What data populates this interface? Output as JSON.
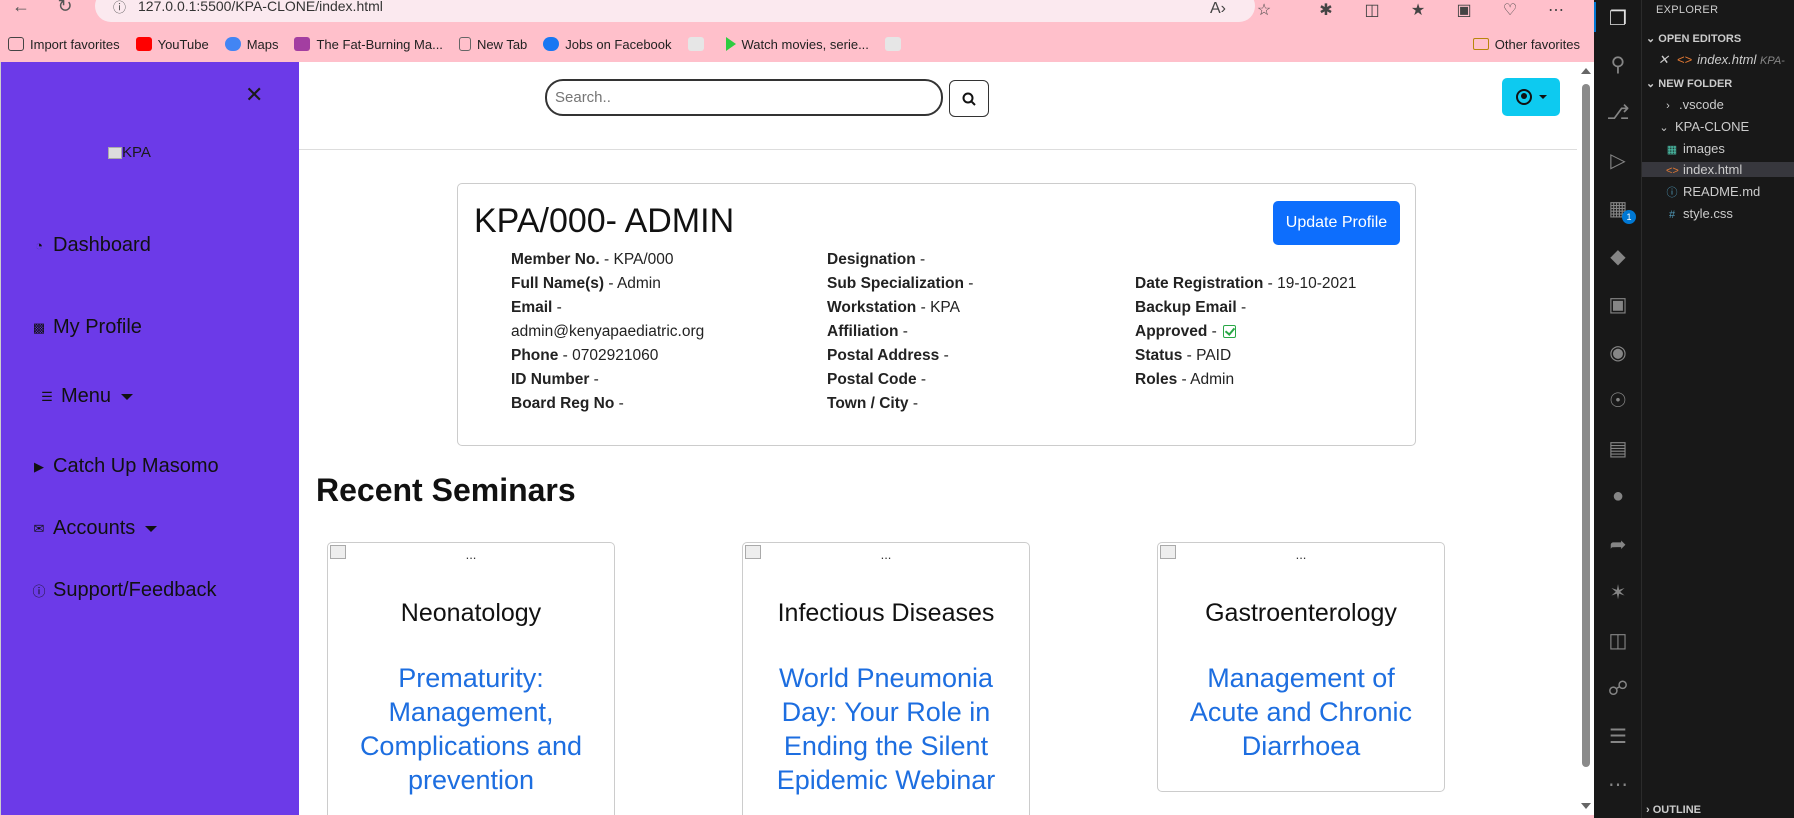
{
  "browser": {
    "url": "127.0.0.1:5500/KPA-CLONE/index.html",
    "favorites": [
      {
        "label": "Import favorites",
        "icon": "import-icon",
        "color": "#444444"
      },
      {
        "label": "YouTube",
        "icon": "youtube-icon",
        "color": "#ff0000"
      },
      {
        "label": "Maps",
        "icon": "google-icon",
        "color": "#4285f4"
      },
      {
        "label": "The Fat-Burning Ma...",
        "icon": "page-icon",
        "color": "#a33ea1"
      },
      {
        "label": "New Tab",
        "icon": "page-icon",
        "color": "#666666"
      },
      {
        "label": "Jobs on Facebook",
        "icon": "facebook-icon",
        "color": "#1877f2"
      },
      {
        "label": "",
        "icon": "page-icon",
        "color": "#dddddd"
      },
      {
        "label": "Watch movies, serie...",
        "icon": "play-icon",
        "color": "#2ecc40"
      },
      {
        "label": "",
        "icon": "page-icon",
        "color": "#dddddd"
      }
    ],
    "other_favorites": "Other favorites"
  },
  "sidebar": {
    "logo_alt": "KPA",
    "items": [
      {
        "label": "Dashboard",
        "icon": "gauge-icon"
      },
      {
        "label": "My Profile",
        "icon": "profile-icon"
      },
      {
        "label": "Menu",
        "icon": "menu-icon"
      },
      {
        "label": "Catch Up Masomo",
        "icon": "youtube-icon"
      },
      {
        "label": "Accounts",
        "icon": "envelope-icon"
      },
      {
        "label": "Support/Feedback",
        "icon": "question-icon"
      }
    ]
  },
  "search": {
    "placeholder": "Search.."
  },
  "profile": {
    "title": "KPA/000- ADMIN",
    "update_label": "Update Profile",
    "col1": [
      {
        "label": "Member No.",
        "value": "KPA/000"
      },
      {
        "label": "Full Name(s)",
        "value": "Admin"
      },
      {
        "label": "Email",
        "value": ""
      },
      {
        "label": "",
        "value": "admin@kenyapaediatric.org"
      },
      {
        "label": "Phone",
        "value": "0702921060"
      },
      {
        "label": "ID Number",
        "value": ""
      },
      {
        "label": "Board Reg No",
        "value": ""
      }
    ],
    "col2": [
      {
        "label": "Designation",
        "value": ""
      },
      {
        "label": "Sub Specialization",
        "value": ""
      },
      {
        "label": "Workstation",
        "value": "KPA"
      },
      {
        "label": "Affiliation",
        "value": ""
      },
      {
        "label": "Postal Address",
        "value": ""
      },
      {
        "label": "Postal Code",
        "value": ""
      },
      {
        "label": "Town / City",
        "value": ""
      }
    ],
    "col3": [
      {
        "label": "Date Registration",
        "value": "19-10-2021"
      },
      {
        "label": "Backup Email",
        "value": ""
      },
      {
        "label": "Approved",
        "value": ""
      },
      {
        "label": "Status",
        "value": "PAID"
      },
      {
        "label": "Roles",
        "value": "Admin"
      }
    ]
  },
  "seminars": {
    "title": "Recent Seminars",
    "cards": [
      {
        "img_alt": "...",
        "category": "Neonatology",
        "title": "Prematurity: Management, Complications and prevention"
      },
      {
        "img_alt": "...",
        "category": "Infectious Diseases",
        "title": "World Pneumonia Day: Your Role in Ending the Silent Epidemic Webinar"
      },
      {
        "img_alt": "...",
        "category": "Gastroenterology",
        "title": "Management of Acute and Chronic Diarrhoea"
      }
    ]
  },
  "vscode": {
    "explorer_title": "EXPLORER",
    "open_editors": "OPEN EDITORS",
    "open_file": "index.html",
    "open_file_path": "KPA-",
    "folder": "NEW FOLDER",
    "tree": [
      ".vscode",
      "KPA-CLONE",
      "images",
      "index.html",
      "README.md",
      "style.css"
    ],
    "outline": "OUTLINE",
    "extensions_badge": "1"
  }
}
